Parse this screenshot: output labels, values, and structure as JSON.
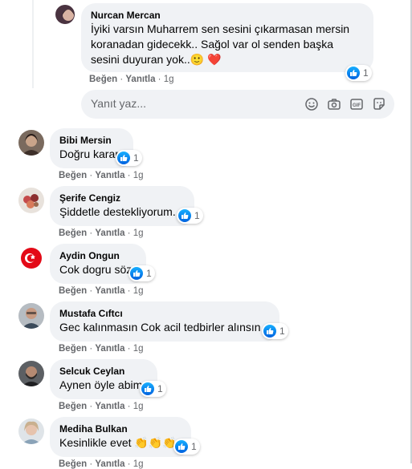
{
  "colors": {
    "bubble": "#f0f2f5",
    "meta": "#65676b",
    "like": "#1877f2"
  },
  "top_comment": {
    "author": "Nurcan Mercan",
    "line1": "İyiki varsın Muharrem sen sesini çıkarmasan mersin",
    "line2": "koranadan gidecekk.. Sağol var ol senden başka",
    "line3": "sesini duyuran yok..",
    "emoji": "🙂 ❤️",
    "like": "Beğen",
    "reply": "Yanıtla",
    "time": "1g",
    "reactions": "1"
  },
  "reply_box": {
    "placeholder": "Yanıt yaz...",
    "icons": [
      "smiley-icon",
      "camera-icon",
      "gif-icon",
      "sticker-icon"
    ]
  },
  "comments": [
    {
      "author": "Bibi Mersin",
      "text": "Doğru karar",
      "like": "Beğen",
      "reply": "Yanıtla",
      "time": "1g",
      "reactions": "1"
    },
    {
      "author": "Şerife Cengiz",
      "text": "Şiddetle destekliyorum.",
      "like": "Beğen",
      "reply": "Yanıtla",
      "time": "1g",
      "reactions": "1"
    },
    {
      "author": "Aydin Ongun",
      "text": "Cok dogru söz",
      "like": "Beğen",
      "reply": "Yanıtla",
      "time": "1g",
      "reactions": "1"
    },
    {
      "author": "Mustafa Cıftcı",
      "text": "Gec kalınmasın Cok acil tedbirler alınsın",
      "like": "Beğen",
      "reply": "Yanıtla",
      "time": "1g",
      "reactions": "1"
    },
    {
      "author": "Selcuk Ceylan",
      "text": "Aynen öyle abim",
      "like": "Beğen",
      "reply": "Yanıtla",
      "time": "1g",
      "reactions": "1"
    },
    {
      "author": "Mediha Bulkan",
      "text": "Kesinlikle evet",
      "emoji": "👏👏👏",
      "like": "Beğen",
      "reply": "Yanıtla",
      "time": "1g",
      "reactions": "1"
    }
  ]
}
